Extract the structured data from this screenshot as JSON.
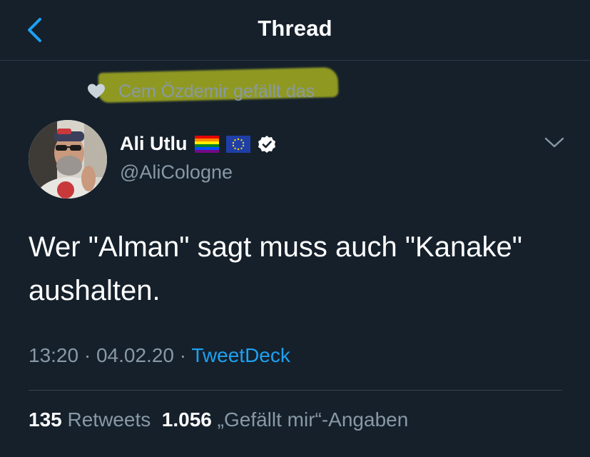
{
  "header": {
    "title": "Thread",
    "back_icon": "chevron-left-icon",
    "accent": "#1da1f2"
  },
  "social_context": {
    "text": "Cem Özdemir gefällt das",
    "icon": "heart-icon",
    "highlight_color": "#c5cc1f"
  },
  "tweet": {
    "author_name": "Ali Utlu",
    "author_flags": [
      "rainbow-flag-icon",
      "eu-flag-icon"
    ],
    "verified_icon": "verified-badge-icon",
    "handle": "@AliCologne",
    "text": "Wer \"Alman\" sagt muss auch \"Kanake\" aushalten.",
    "time": "13:20",
    "date": "04.02.20",
    "source": "TweetDeck",
    "menu_icon": "chevron-down-icon"
  },
  "stats": {
    "retweets_count": "135",
    "retweets_label": "Retweets",
    "likes_count": "1.056",
    "likes_label": "„Gefällt mir“-Angaben"
  },
  "colors": {
    "background": "#15202b",
    "secondary_text": "#8899a6",
    "divider": "#38444d"
  }
}
